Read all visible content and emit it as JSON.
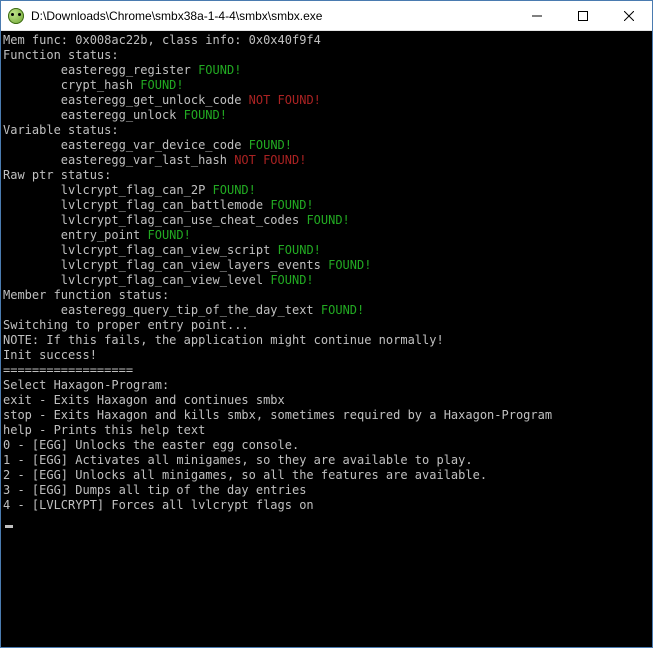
{
  "window": {
    "title": "D:\\Downloads\\Chrome\\smbx38a-1-4-4\\smbx\\smbx.exe"
  },
  "console": {
    "mem_func_line": "Mem func: 0x008ac22b, class info: 0x0x40f9f4",
    "section_function": "Function status:",
    "functions": [
      {
        "name": "easteregg_register",
        "status": "FOUND!",
        "cls": "green"
      },
      {
        "name": "crypt_hash",
        "status": "FOUND!",
        "cls": "green"
      },
      {
        "name": "easteregg_get_unlock_code",
        "status": "NOT FOUND!",
        "cls": "red"
      },
      {
        "name": "easteregg_unlock",
        "status": "FOUND!",
        "cls": "green"
      }
    ],
    "section_variable": "Variable status:",
    "variables": [
      {
        "name": "easteregg_var_device_code",
        "status": "FOUND!",
        "cls": "green"
      },
      {
        "name": "easteregg_var_last_hash",
        "status": "NOT FOUND!",
        "cls": "red"
      }
    ],
    "section_rawptr": "Raw ptr status:",
    "rawptrs": [
      {
        "name": "lvlcrypt_flag_can_2P",
        "status": "FOUND!",
        "cls": "green"
      },
      {
        "name": "lvlcrypt_flag_can_battlemode",
        "status": "FOUND!",
        "cls": "green"
      },
      {
        "name": "lvlcrypt_flag_can_use_cheat_codes",
        "status": "FOUND!",
        "cls": "green"
      },
      {
        "name": "entry_point",
        "status": "FOUND!",
        "cls": "green"
      },
      {
        "name": "lvlcrypt_flag_can_view_script",
        "status": "FOUND!",
        "cls": "green"
      },
      {
        "name": "lvlcrypt_flag_can_view_layers_events",
        "status": "FOUND!",
        "cls": "green"
      },
      {
        "name": "lvlcrypt_flag_can_view_level",
        "status": "FOUND!",
        "cls": "green"
      }
    ],
    "section_memberfn": "Member function status:",
    "memberfns": [
      {
        "name": "easteregg_query_tip_of_the_day_text",
        "status": "FOUND!",
        "cls": "green"
      }
    ],
    "switching": "Switching to proper entry point...",
    "note": "NOTE: If this fails, the application might continue normally!",
    "init": "Init success!",
    "divider": "==================",
    "select": "Select Haxagon-Program:",
    "menu": [
      "exit - Exits Haxagon and continues smbx",
      "stop - Exits Haxagon and kills smbx, sometimes required by a Haxagon-Program",
      "help - Prints this help text",
      "0 - [EGG] Unlocks the easter egg console.",
      "1 - [EGG] Activates all minigames, so they are available to play.",
      "2 - [EGG] Unlocks all minigames, so all the features are available.",
      "3 - [EGG] Dumps all tip of the day entries",
      "4 - [LVLCRYPT] Forces all lvlcrypt flags on"
    ]
  }
}
